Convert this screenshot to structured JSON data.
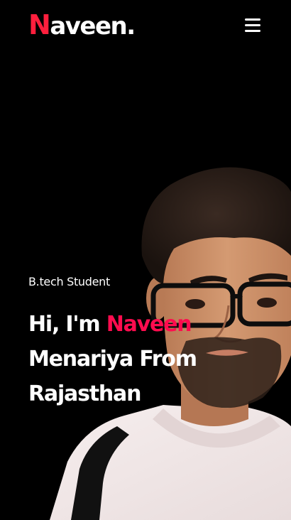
{
  "header": {
    "logo_first": "N",
    "logo_rest": "aveen",
    "logo_dot": ".",
    "menu_icon": "hamburger-menu-icon"
  },
  "hero": {
    "subtitle": "B.tech Student",
    "heading_prefix": "Hi, I'm ",
    "heading_name": "Naveen",
    "heading_line2": "Menariya From",
    "heading_line3": "Rajasthan"
  },
  "colors": {
    "background": "#000000",
    "logo_accent": "#ff1f3d",
    "name_accent": "#ff0c4f",
    "text": "#ffffff"
  }
}
